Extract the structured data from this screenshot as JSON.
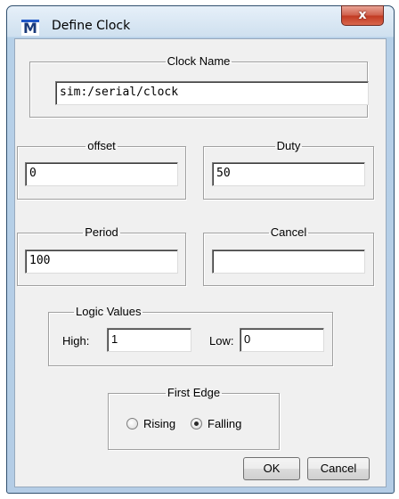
{
  "window": {
    "title": "Define Clock",
    "icon": "M",
    "close_glyph": "x"
  },
  "clock_name": {
    "legend": "Clock Name",
    "value": "sim:/serial/clock"
  },
  "offset": {
    "legend": "offset",
    "value": "0"
  },
  "duty": {
    "legend": "Duty",
    "value": "50"
  },
  "period": {
    "legend": "Period",
    "value": "100"
  },
  "cancel_group": {
    "legend": "Cancel",
    "value": ""
  },
  "logic_values": {
    "legend": "Logic Values",
    "high_label": "High:",
    "high_value": "1",
    "low_label": "Low:",
    "low_value": "0"
  },
  "first_edge": {
    "legend": "First Edge",
    "rising_label": "Rising",
    "falling_label": "Falling",
    "selected": "Falling"
  },
  "buttons": {
    "ok": "OK",
    "cancel": "Cancel"
  }
}
